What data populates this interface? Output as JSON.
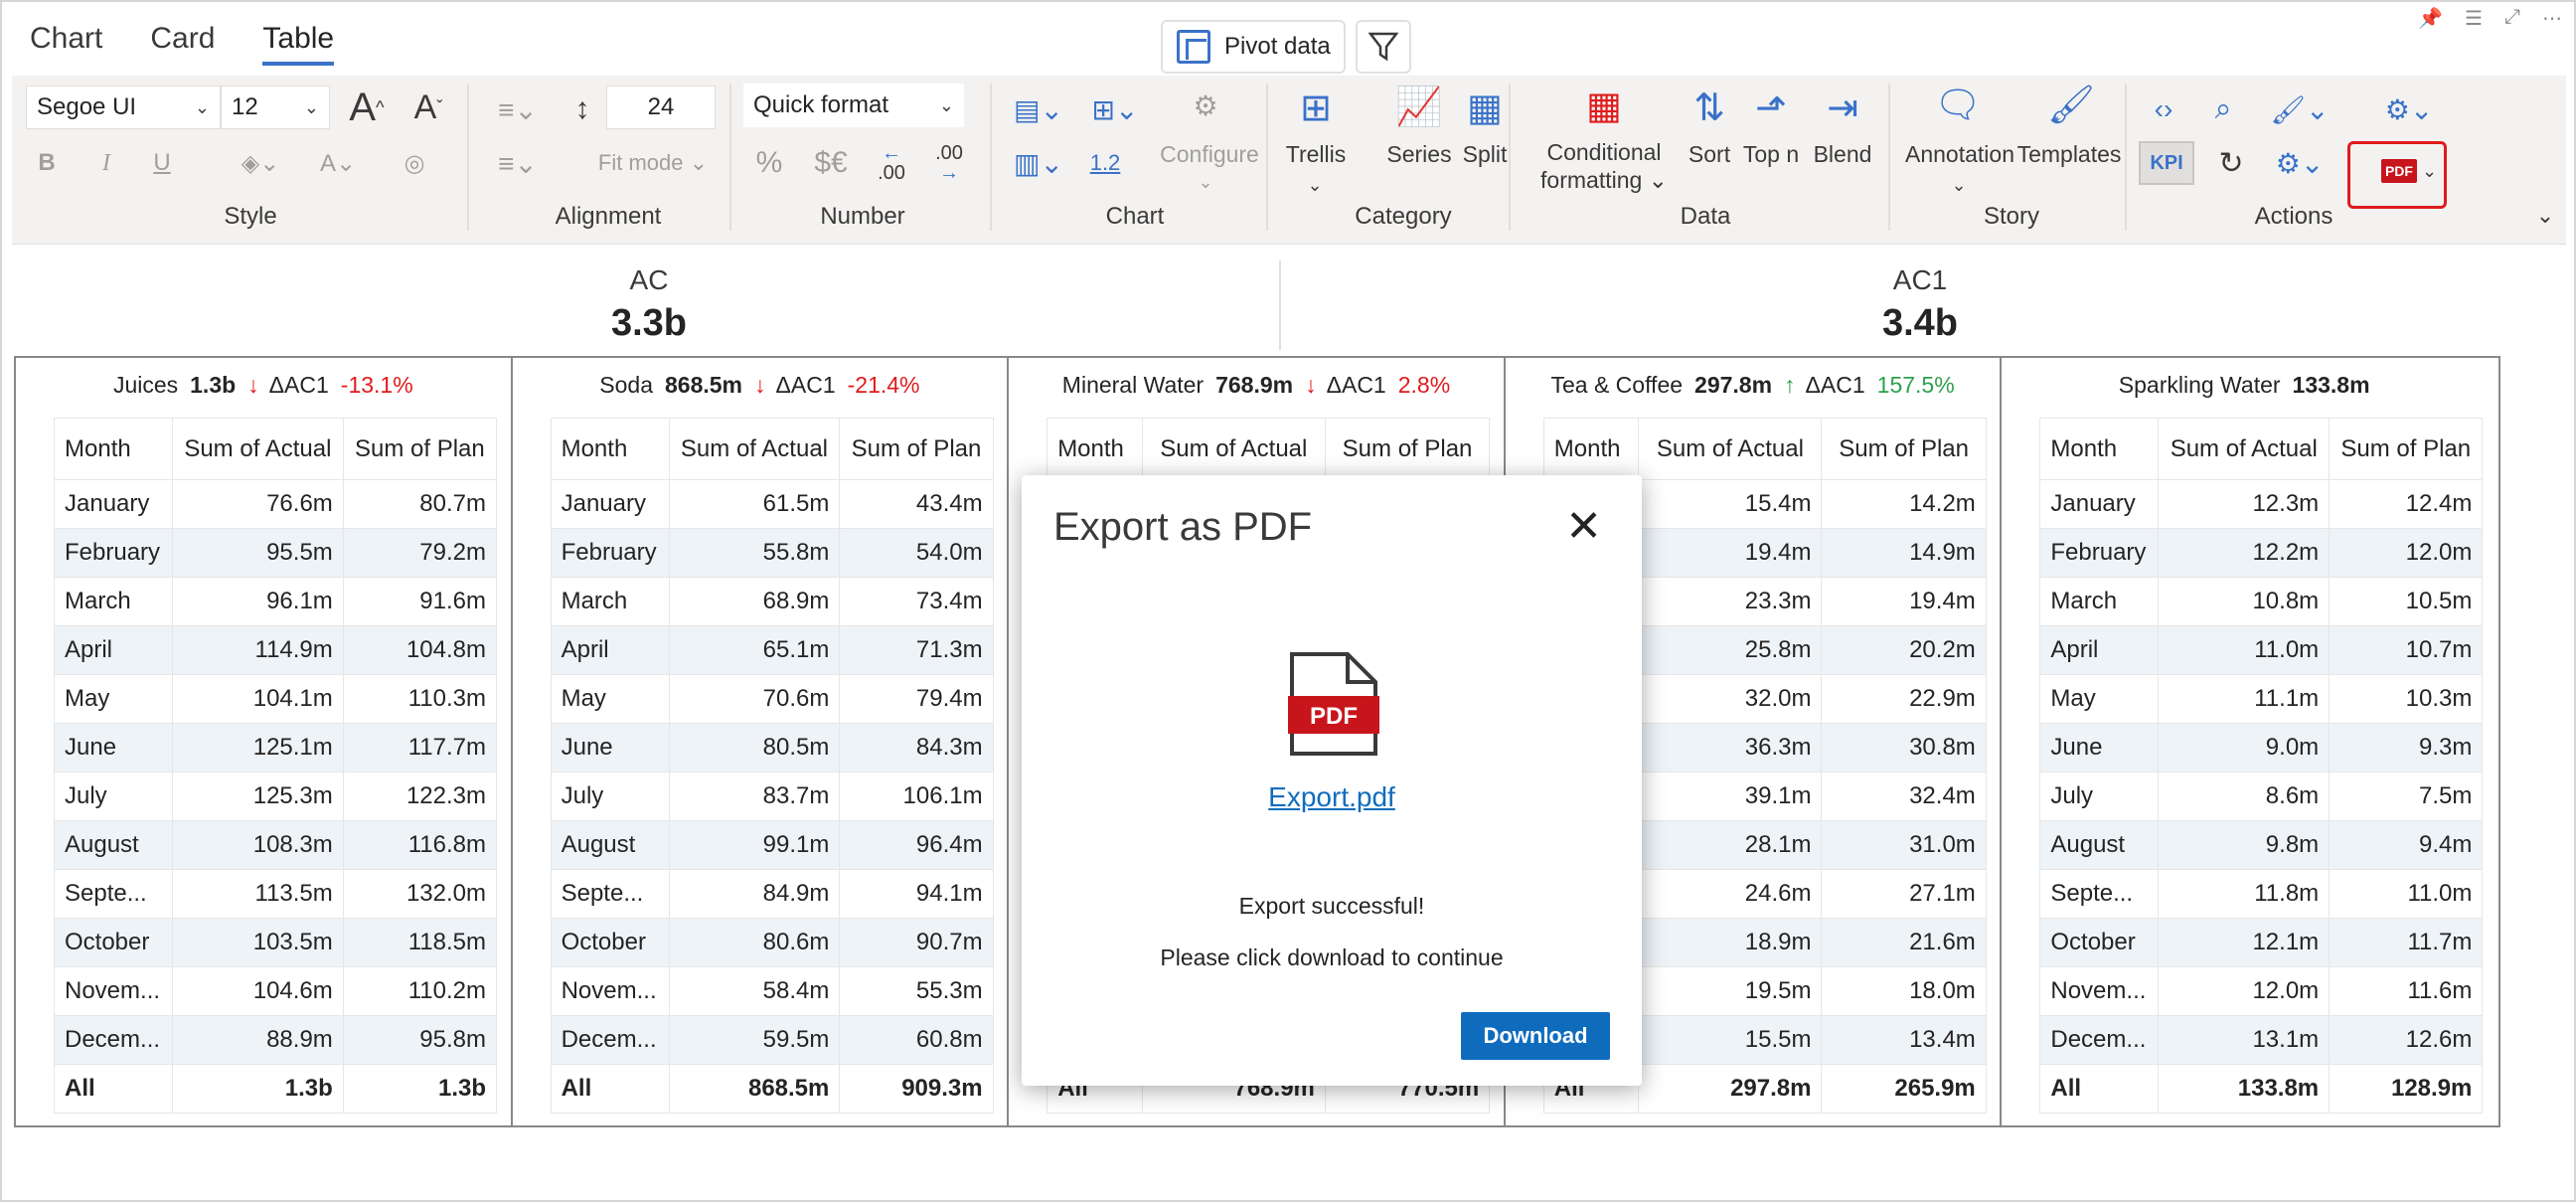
{
  "tabs": [
    {
      "label": "Chart"
    },
    {
      "label": "Card"
    },
    {
      "label": "Table"
    }
  ],
  "toolbar": {
    "pivot_label": "Pivot data",
    "font_family": "Segoe UI",
    "font_size": "12",
    "line_height": "24",
    "quick_format": "Quick format",
    "fit_mode": "Fit mode",
    "configure": "Configure",
    "num_format_1": "%",
    "num_format_2": "$€",
    "decimal_dec": ".00",
    "decimal_inc": ".00",
    "one_point_two": "1.2",
    "kpi": "KPI",
    "trellis": "Trellis",
    "series": "Series",
    "split": "Split",
    "conditional_formatting_1": "Conditional",
    "conditional_formatting_2": "formatting",
    "sort": "Sort",
    "top_n": "Top n",
    "blend": "Blend",
    "annotation": "Annotation",
    "templates": "Templates",
    "groups": {
      "style": "Style",
      "alignment": "Alignment",
      "number": "Number",
      "chart": "Chart",
      "category": "Category",
      "data": "Data",
      "story": "Story",
      "actions": "Actions"
    }
  },
  "header_kpis": [
    {
      "title": "AC",
      "value": "3.3b"
    },
    {
      "title": "AC1",
      "value": "3.4b"
    }
  ],
  "columns": [
    "Month",
    "Sum of Actual",
    "Sum of Plan"
  ],
  "panels": [
    {
      "name": "Juices",
      "total": "1.3b",
      "trend": "down",
      "delta_label": "ΔAC1",
      "delta": "-13.1%",
      "rows": [
        [
          "January",
          "76.6m",
          "80.7m"
        ],
        [
          "February",
          "95.5m",
          "79.2m"
        ],
        [
          "March",
          "96.1m",
          "91.6m"
        ],
        [
          "April",
          "114.9m",
          "104.8m"
        ],
        [
          "May",
          "104.1m",
          "110.3m"
        ],
        [
          "June",
          "125.1m",
          "117.7m"
        ],
        [
          "July",
          "125.3m",
          "122.3m"
        ],
        [
          "August",
          "108.3m",
          "116.8m"
        ],
        [
          "Septe...",
          "113.5m",
          "132.0m"
        ],
        [
          "October",
          "103.5m",
          "118.5m"
        ],
        [
          "Novem...",
          "104.6m",
          "110.2m"
        ],
        [
          "Decem...",
          "88.9m",
          "95.8m"
        ]
      ],
      "totals": [
        "All",
        "1.3b",
        "1.3b"
      ]
    },
    {
      "name": "Soda",
      "total": "868.5m",
      "trend": "down",
      "delta_label": "ΔAC1",
      "delta": "-21.4%",
      "rows": [
        [
          "January",
          "61.5m",
          "43.4m"
        ],
        [
          "February",
          "55.8m",
          "54.0m"
        ],
        [
          "March",
          "68.9m",
          "73.4m"
        ],
        [
          "April",
          "65.1m",
          "71.3m"
        ],
        [
          "May",
          "70.6m",
          "79.4m"
        ],
        [
          "June",
          "80.5m",
          "84.3m"
        ],
        [
          "July",
          "83.7m",
          "106.1m"
        ],
        [
          "August",
          "99.1m",
          "96.4m"
        ],
        [
          "Septe...",
          "84.9m",
          "94.1m"
        ],
        [
          "October",
          "80.6m",
          "90.7m"
        ],
        [
          "Novem...",
          "58.4m",
          "55.3m"
        ],
        [
          "Decem...",
          "59.5m",
          "60.8m"
        ]
      ],
      "totals": [
        "All",
        "868.5m",
        "909.3m"
      ]
    },
    {
      "name": "Mineral Water",
      "total": "768.9m",
      "trend": "down",
      "delta_label": "ΔAC1",
      "delta": "2.8%",
      "rows": [],
      "totals": [
        "All",
        "768.9m",
        "770.5m"
      ]
    },
    {
      "name": "Tea & Coffee",
      "total": "297.8m",
      "trend": "up",
      "delta_label": "ΔAC1",
      "delta": "157.5%",
      "rows": [
        [
          "",
          "15.4m",
          "14.2m"
        ],
        [
          "",
          "19.4m",
          "14.9m"
        ],
        [
          "",
          "23.3m",
          "19.4m"
        ],
        [
          "",
          "25.8m",
          "20.2m"
        ],
        [
          "",
          "32.0m",
          "22.9m"
        ],
        [
          "",
          "36.3m",
          "30.8m"
        ],
        [
          "",
          "39.1m",
          "32.4m"
        ],
        [
          "",
          "28.1m",
          "31.0m"
        ],
        [
          "",
          "24.6m",
          "27.1m"
        ],
        [
          "",
          "18.9m",
          "21.6m"
        ],
        [
          "",
          "19.5m",
          "18.0m"
        ],
        [
          "",
          "15.5m",
          "13.4m"
        ]
      ],
      "totals": [
        "All",
        "297.8m",
        "265.9m"
      ]
    },
    {
      "name": "Sparkling Water",
      "total": "133.8m",
      "trend": "",
      "delta_label": "",
      "delta": "",
      "rows": [
        [
          "January",
          "12.3m",
          "12.4m"
        ],
        [
          "February",
          "12.2m",
          "12.0m"
        ],
        [
          "March",
          "10.8m",
          "10.5m"
        ],
        [
          "April",
          "11.0m",
          "10.7m"
        ],
        [
          "May",
          "11.1m",
          "10.3m"
        ],
        [
          "June",
          "9.0m",
          "9.3m"
        ],
        [
          "July",
          "8.6m",
          "7.5m"
        ],
        [
          "August",
          "9.8m",
          "9.4m"
        ],
        [
          "Septe...",
          "11.8m",
          "11.0m"
        ],
        [
          "October",
          "12.1m",
          "11.7m"
        ],
        [
          "Novem...",
          "12.0m",
          "11.6m"
        ],
        [
          "Decem...",
          "13.1m",
          "12.6m"
        ]
      ],
      "totals": [
        "All",
        "133.8m",
        "128.9m"
      ]
    }
  ],
  "modal": {
    "title": "Export as PDF",
    "file_icon_text": "PDF",
    "file_link": "Export.pdf",
    "message1": "Export successful!",
    "message2": "Please click download to continue",
    "download_label": "Download"
  },
  "colors": {
    "accent": "#0f6cbd",
    "down": "#e01b1b",
    "up": "#2ea04d",
    "alt_row": "#eef3f8"
  }
}
